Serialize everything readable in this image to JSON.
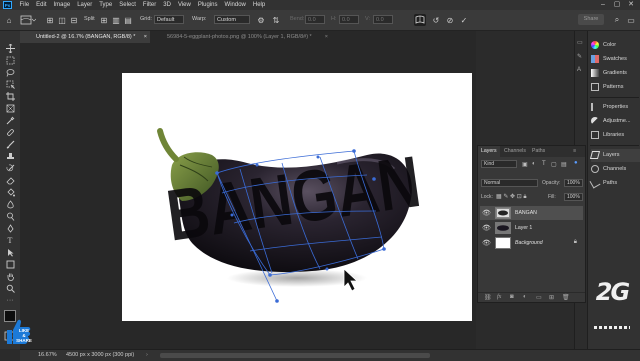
{
  "menu": [
    "File",
    "Edit",
    "Image",
    "Layer",
    "Type",
    "Select",
    "Filter",
    "3D",
    "View",
    "Plugins",
    "Window",
    "Help"
  ],
  "app_logo_text": "Ps",
  "window_controls": {
    "minimize": "–",
    "maximize": "▢",
    "close": "✕"
  },
  "options": {
    "split_label": "Split",
    "grid_label": "Grid:",
    "grid_value": "Default",
    "warp_label": "Warp:",
    "warp_value": "Custom",
    "bend_label": "Bend:",
    "bend_value": "0.0",
    "h_label": "H:",
    "h_value": "0.0",
    "v_label": "V:",
    "v_value": "0.0",
    "share_label": "Share"
  },
  "tabs": [
    {
      "label": "Untitled-2 @ 16.7% (BANGAN, RGB/8) *",
      "close": "×"
    },
    {
      "label": "56984-5-eggplant-photos.png @ 100% (Layer 1, RGB/8#) *",
      "close": "×"
    }
  ],
  "canvas": {
    "warp_text": "BANGAN"
  },
  "dock": [
    {
      "label": "Color",
      "icon": "color-wheel-icon",
      "color": "#e05050"
    },
    {
      "label": "Swatches",
      "icon": "swatches-icon",
      "color": "#6aa0e0"
    },
    {
      "label": "Gradients",
      "icon": "gradient-icon",
      "color": "#c0c0c0"
    },
    {
      "label": "Patterns",
      "icon": "patterns-icon",
      "color": "#c0c0c0"
    },
    {
      "label": "Properties",
      "icon": "properties-icon",
      "color": "#c0c0c0"
    },
    {
      "label": "Adjustme...",
      "icon": "adjustments-icon",
      "color": "#c0c0c0"
    },
    {
      "label": "Libraries",
      "icon": "libraries-icon",
      "color": "#c0c0c0"
    },
    {
      "label": "Layers",
      "icon": "layers-icon",
      "color": "#c0c0c0"
    },
    {
      "label": "Channels",
      "icon": "channels-icon",
      "color": "#c0c0c0"
    },
    {
      "label": "Paths",
      "icon": "paths-icon",
      "color": "#c0c0c0"
    }
  ],
  "layers_panel": {
    "tabs": [
      "Layers",
      "Channels",
      "Paths"
    ],
    "filter_label": "Kind",
    "blend_mode": "Normal",
    "opacity_label": "Opacity:",
    "opacity_value": "100%",
    "lock_label": "Lock:",
    "fill_label": "Fill:",
    "fill_value": "100%",
    "layers": [
      {
        "name": "BANGAN",
        "selected": true
      },
      {
        "name": "Layer 1",
        "selected": false
      },
      {
        "name": "Background",
        "selected": false,
        "locked": true
      }
    ]
  },
  "status": {
    "zoom": "16.67%",
    "doc_info": "4500 px x 3000 px (300 ppi)"
  },
  "watermark_left": {
    "line1": "LIKE",
    "line2": "& SHARE"
  },
  "watermark_right": "2G",
  "colors": {
    "accent": "#31a8ff",
    "warp_mesh": "#3a6bd6",
    "eggplant": "#1a1620"
  }
}
